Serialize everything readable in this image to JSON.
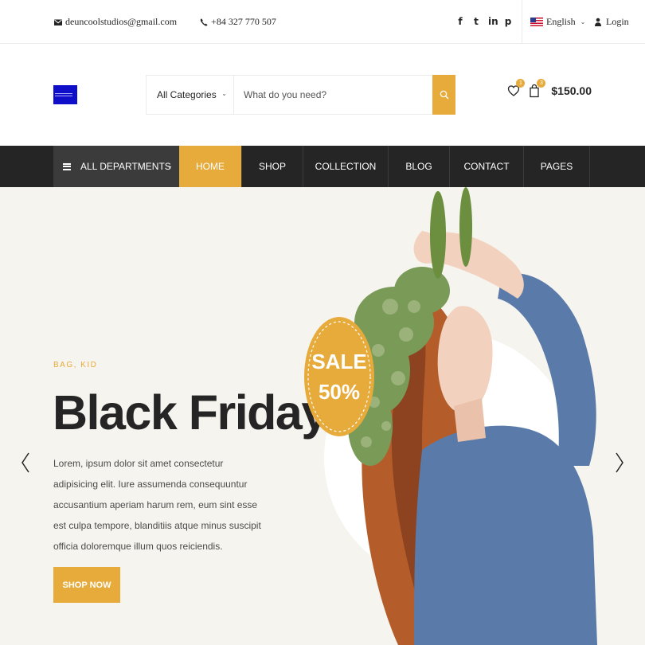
{
  "topbar": {
    "email": "deuncoolstudios@gmail.com",
    "phone": "+84 327 770 507",
    "social_icons": [
      "facebook-icon",
      "twitter-icon",
      "linkedin-icon",
      "pinterest-icon"
    ],
    "social_glyphs": [
      "f",
      "t",
      "in",
      "p"
    ],
    "language": "English",
    "login": "Login"
  },
  "header": {
    "category_select": "All Categories",
    "search_placeholder": "What do you need?",
    "wishlist_count": "1",
    "cart_count": "3",
    "cart_total": "$150.00"
  },
  "nav": {
    "departments": "ALL DEPARTMENTS",
    "items": [
      "HOME",
      "SHOP",
      "COLLECTION",
      "BLOG",
      "CONTACT",
      "PAGES"
    ],
    "active": "HOME"
  },
  "hero": {
    "eyebrow": "BAG, KID",
    "title": "Black Friday",
    "description": "Lorem, ipsum dolor sit amet consectetur adipisicing elit. Iure assumenda consequuntur accusantium aperiam harum rem, eum sint esse est culpa tempore, blanditiis atque minus suscipit officia doloremque illum quos reiciendis.",
    "button": "SHOP NOW",
    "sale_line1": "SALE",
    "sale_line2": "50%"
  },
  "colors": {
    "accent": "#e7ab3c",
    "nav_bg": "#252525",
    "dept_bg": "#3b3b3b",
    "hero_bg": "#f6f4ee"
  }
}
